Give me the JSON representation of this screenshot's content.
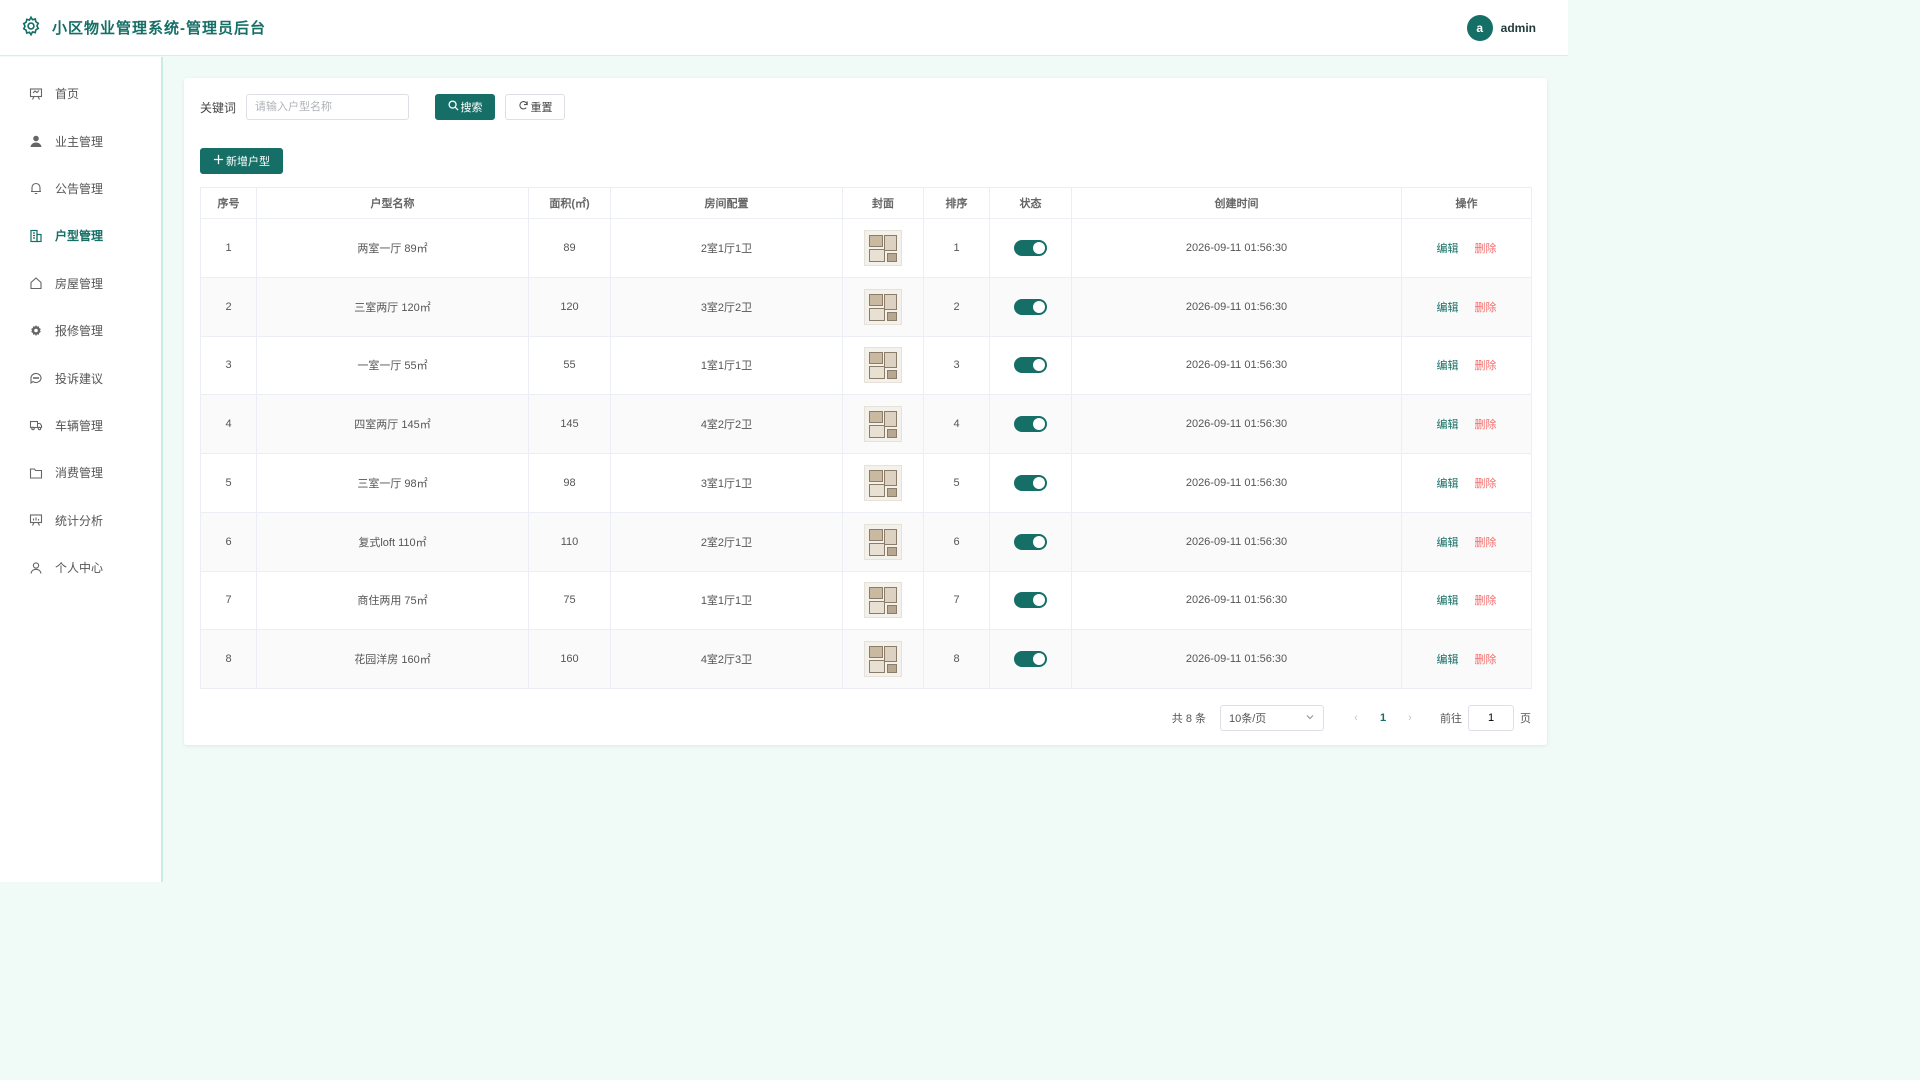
{
  "header": {
    "title": "小区物业管理系统-管理员后台",
    "avatar_letter": "a",
    "username": "admin"
  },
  "sidebar": {
    "items": [
      {
        "label": "首页",
        "icon": "presentation-icon",
        "active": false
      },
      {
        "label": "业主管理",
        "icon": "user-icon",
        "active": false
      },
      {
        "label": "公告管理",
        "icon": "bell-icon",
        "active": false
      },
      {
        "label": "户型管理",
        "icon": "building-icon",
        "active": true
      },
      {
        "label": "房屋管理",
        "icon": "house-icon",
        "active": false
      },
      {
        "label": "报修管理",
        "icon": "gear-icon",
        "active": false
      },
      {
        "label": "投诉建议",
        "icon": "chat-icon",
        "active": false
      },
      {
        "label": "车辆管理",
        "icon": "truck-icon",
        "active": false
      },
      {
        "label": "消费管理",
        "icon": "folder-icon",
        "active": false
      },
      {
        "label": "统计分析",
        "icon": "chart-board-icon",
        "active": false
      },
      {
        "label": "个人中心",
        "icon": "person-icon",
        "active": false
      }
    ]
  },
  "search": {
    "keyword_label": "关键词",
    "placeholder": "请输入户型名称",
    "value": "",
    "search_label": "搜索",
    "reset_label": "重置"
  },
  "toolbar": {
    "add_label": "新增户型"
  },
  "table": {
    "columns": [
      "序号",
      "户型名称",
      "面积(㎡)",
      "房间配置",
      "封面",
      "排序",
      "状态",
      "创建时间",
      "操作"
    ],
    "edit_label": "编辑",
    "delete_label": "删除",
    "rows": [
      {
        "index": "1",
        "name": "两室一厅 89㎡",
        "area": "89",
        "config": "2室1厅1卫",
        "sort": "1",
        "enabled": true,
        "created": "2026-09-11 01:56:30"
      },
      {
        "index": "2",
        "name": "三室两厅 120㎡",
        "area": "120",
        "config": "3室2厅2卫",
        "sort": "2",
        "enabled": true,
        "created": "2026-09-11 01:56:30"
      },
      {
        "index": "3",
        "name": "一室一厅 55㎡",
        "area": "55",
        "config": "1室1厅1卫",
        "sort": "3",
        "enabled": true,
        "created": "2026-09-11 01:56:30"
      },
      {
        "index": "4",
        "name": "四室两厅 145㎡",
        "area": "145",
        "config": "4室2厅2卫",
        "sort": "4",
        "enabled": true,
        "created": "2026-09-11 01:56:30"
      },
      {
        "index": "5",
        "name": "三室一厅 98㎡",
        "area": "98",
        "config": "3室1厅1卫",
        "sort": "5",
        "enabled": true,
        "created": "2026-09-11 01:56:30"
      },
      {
        "index": "6",
        "name": "复式loft 110㎡",
        "area": "110",
        "config": "2室2厅1卫",
        "sort": "6",
        "enabled": true,
        "created": "2026-09-11 01:56:30"
      },
      {
        "index": "7",
        "name": "商住两用 75㎡",
        "area": "75",
        "config": "1室1厅1卫",
        "sort": "7",
        "enabled": true,
        "created": "2026-09-11 01:56:30"
      },
      {
        "index": "8",
        "name": "花园洋房 160㎡",
        "area": "160",
        "config": "4室2厅3卫",
        "sort": "8",
        "enabled": true,
        "created": "2026-09-11 01:56:30"
      }
    ]
  },
  "pagination": {
    "total_text": "共 8 条",
    "page_size": "10条/页",
    "current_page": "1",
    "goto_label": "前往",
    "goto_value": "1",
    "page_suffix": "页"
  },
  "colors": {
    "primary": "#156f66",
    "danger": "#f56c6c",
    "background": "#f0fbf8"
  }
}
